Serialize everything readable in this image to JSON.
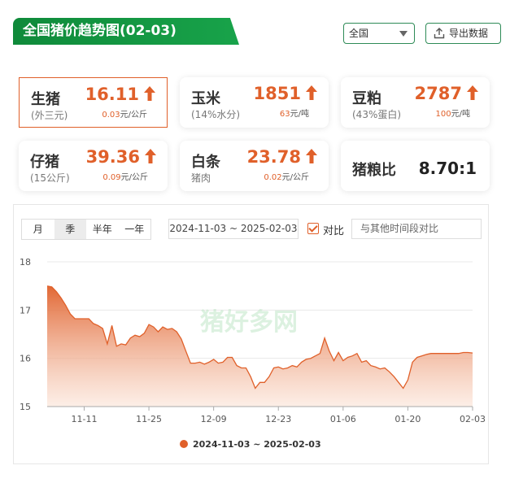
{
  "header": {
    "title": "全国猪价趋势图(02-03)",
    "region_value": "全国",
    "export_label": "导出数据"
  },
  "cards": {
    "live_pig": {
      "name": "生猪",
      "sub": "(外三元)",
      "price": "16.11",
      "change": "0.03",
      "unit": "元/公斤",
      "trend": "up"
    },
    "corn": {
      "name": "玉米",
      "sub": "(14%水分)",
      "price": "1851",
      "change": "63",
      "unit": "元/吨",
      "trend": "up"
    },
    "soymeal": {
      "name": "豆粕",
      "sub": "(43%蛋白)",
      "price": "2787",
      "change": "100",
      "unit": "元/吨",
      "trend": "up"
    },
    "piglet": {
      "name": "仔猪",
      "sub": "(15公斤)",
      "price": "39.36",
      "change": "0.09",
      "unit": "元/公斤",
      "trend": "up"
    },
    "carcass": {
      "name": "白条",
      "sub": "猪肉",
      "price": "23.78",
      "change": "0.02",
      "unit": "元/公斤",
      "trend": "up"
    },
    "ratio": {
      "name": "猪粮比",
      "value": "8.70:1"
    }
  },
  "controls": {
    "period_tabs": [
      "月",
      "季",
      "半年",
      "一年"
    ],
    "selected_period": "季",
    "date_range": "2024-11-03 ~ 2025-02-03",
    "compare_label": "对比",
    "compare_checked": true,
    "compare_placeholder": "与其他时间段对比"
  },
  "colors": {
    "accent": "#e0602a",
    "brand_green": "#18a34a"
  },
  "watermark": "猪好多网",
  "chart_data": {
    "type": "area",
    "ylim": [
      15,
      18
    ],
    "yticks": [
      "18",
      "17",
      "16",
      "15"
    ],
    "xticks": [
      "11-11",
      "11-25",
      "12-09",
      "12-23",
      "01-06",
      "01-20",
      "02-03"
    ],
    "grid": true,
    "legend_position": "bottom",
    "series": [
      {
        "name": "2024-11-03 ~ 2025-02-03",
        "x": [
          "11-03",
          "11-04",
          "11-05",
          "11-06",
          "11-07",
          "11-08",
          "11-09",
          "11-10",
          "11-11",
          "11-12",
          "11-13",
          "11-14",
          "11-15",
          "11-16",
          "11-17",
          "11-18",
          "11-19",
          "11-20",
          "11-21",
          "11-22",
          "11-23",
          "11-24",
          "11-25",
          "11-26",
          "11-27",
          "11-28",
          "11-29",
          "11-30",
          "12-01",
          "12-02",
          "12-03",
          "12-04",
          "12-05",
          "12-06",
          "12-07",
          "12-08",
          "12-09",
          "12-10",
          "12-11",
          "12-12",
          "12-13",
          "12-14",
          "12-15",
          "12-16",
          "12-17",
          "12-18",
          "12-19",
          "12-20",
          "12-21",
          "12-22",
          "12-23",
          "12-24",
          "12-25",
          "12-26",
          "12-27",
          "12-28",
          "12-29",
          "12-30",
          "12-31",
          "01-01",
          "01-02",
          "01-03",
          "01-04",
          "01-05",
          "01-06",
          "01-07",
          "01-08",
          "01-09",
          "01-10",
          "01-11",
          "01-12",
          "01-13",
          "01-14",
          "01-15",
          "01-16",
          "01-17",
          "01-18",
          "01-19",
          "01-20",
          "01-21",
          "01-22",
          "01-23",
          "01-24",
          "01-25",
          "01-26",
          "01-27",
          "01-28",
          "01-29",
          "01-30",
          "01-31",
          "02-01",
          "02-02",
          "02-03"
        ],
        "values": [
          17.5,
          17.48,
          17.38,
          17.25,
          17.1,
          16.92,
          16.82,
          16.82,
          16.82,
          16.82,
          16.72,
          16.68,
          16.62,
          16.3,
          16.68,
          16.25,
          16.3,
          16.28,
          16.42,
          16.48,
          16.45,
          16.52,
          16.7,
          16.65,
          16.55,
          16.65,
          16.6,
          16.62,
          16.55,
          16.4,
          16.15,
          15.9,
          15.9,
          15.92,
          15.88,
          15.92,
          15.98,
          15.9,
          15.92,
          16.02,
          16.02,
          15.85,
          15.8,
          15.8,
          15.62,
          15.38,
          15.5,
          15.5,
          15.62,
          15.8,
          15.82,
          15.78,
          15.8,
          15.85,
          15.82,
          15.92,
          15.98,
          16.0,
          16.05,
          16.1,
          16.42,
          16.15,
          15.95,
          16.12,
          15.95,
          16.02,
          16.05,
          16.1,
          15.92,
          15.95,
          15.85,
          15.82,
          15.78,
          15.8,
          15.72,
          15.62,
          15.5,
          15.38,
          15.55,
          15.92,
          16.02,
          16.05,
          16.08,
          16.1,
          16.1,
          16.1,
          16.1,
          16.1,
          16.1,
          16.1,
          16.12,
          16.12,
          16.11
        ]
      }
    ]
  }
}
